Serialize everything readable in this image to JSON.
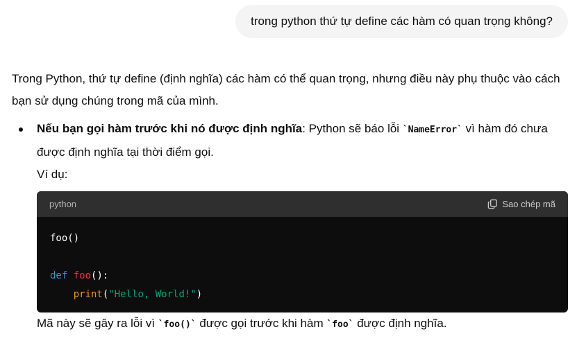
{
  "user_message": "trong python thứ tự define các hàm có quan trọng không?",
  "answer": {
    "intro": "Trong Python, thứ tự define (định nghĩa) các hàm có thể quan trọng, nhưng điều này phụ thuộc vào cách bạn sử dụng chúng trong mã của mình.",
    "bullet1": {
      "bold": "Nếu bạn gọi hàm trước khi nó được định nghĩa",
      "text_a": ": Python sẽ báo lỗi ",
      "code": "`NameError`",
      "text_b": " vì hàm đó chưa được định nghĩa tại thời điểm gọi."
    },
    "example_label": "Ví dụ:",
    "code_block": {
      "language": "python",
      "copy_label": "Sao chép mã",
      "line1": "foo()",
      "line3_kw": "def",
      "line3_fn": "foo",
      "line3_rest": "():",
      "line4_builtin": "print",
      "line4_open": "(",
      "line4_str": "\"Hello, World!\"",
      "line4_close": ")"
    },
    "after": {
      "text_a": "Mã này sẽ gây ra lỗi vì ",
      "code_a": "`foo()`",
      "text_b": " được gọi trước khi hàm ",
      "code_b": "`foo`",
      "text_c": " được định nghĩa."
    }
  },
  "icons": {
    "copy": "copy-icon"
  }
}
